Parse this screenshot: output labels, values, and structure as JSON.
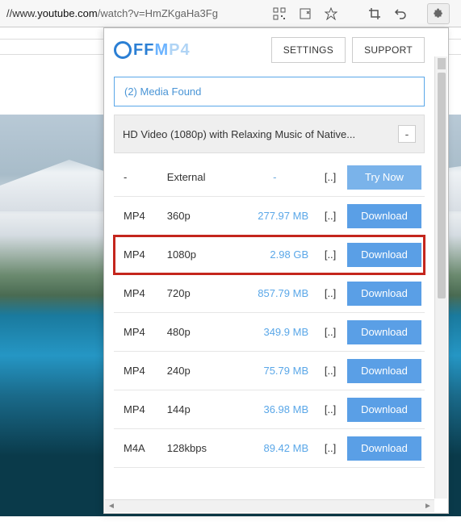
{
  "url": {
    "prefix": "//www.",
    "domain": "youtube.com",
    "path": "/watch?v=HmZKgaHa3Fg"
  },
  "header": {
    "logo_text": "FFMP4",
    "settings_label": "SETTINGS",
    "support_label": "SUPPORT"
  },
  "media_found": "(2) Media Found",
  "video_title": "HD Video (1080p) with Relaxing Music of Native...",
  "collapse_symbol": "-",
  "rows": [
    {
      "format": "-",
      "quality": "External",
      "size": "-",
      "ext": "[..]",
      "button": "Try Now",
      "try": true,
      "highlight": false,
      "dash": true
    },
    {
      "format": "MP4",
      "quality": "360p",
      "size": "277.97 MB",
      "ext": "[..]",
      "button": "Download",
      "try": false,
      "highlight": false,
      "dash": false
    },
    {
      "format": "MP4",
      "quality": "1080p",
      "size": "2.98 GB",
      "ext": "[..]",
      "button": "Download",
      "try": false,
      "highlight": true,
      "dash": false
    },
    {
      "format": "MP4",
      "quality": "720p",
      "size": "857.79 MB",
      "ext": "[..]",
      "button": "Download",
      "try": false,
      "highlight": false,
      "dash": false
    },
    {
      "format": "MP4",
      "quality": "480p",
      "size": "349.9 MB",
      "ext": "[..]",
      "button": "Download",
      "try": false,
      "highlight": false,
      "dash": false
    },
    {
      "format": "MP4",
      "quality": "240p",
      "size": "75.79 MB",
      "ext": "[..]",
      "button": "Download",
      "try": false,
      "highlight": false,
      "dash": false
    },
    {
      "format": "MP4",
      "quality": "144p",
      "size": "36.98 MB",
      "ext": "[..]",
      "button": "Download",
      "try": false,
      "highlight": false,
      "dash": false
    },
    {
      "format": "M4A",
      "quality": "128kbps",
      "size": "89.42 MB",
      "ext": "[..]",
      "button": "Download",
      "try": false,
      "highlight": false,
      "dash": false
    }
  ]
}
